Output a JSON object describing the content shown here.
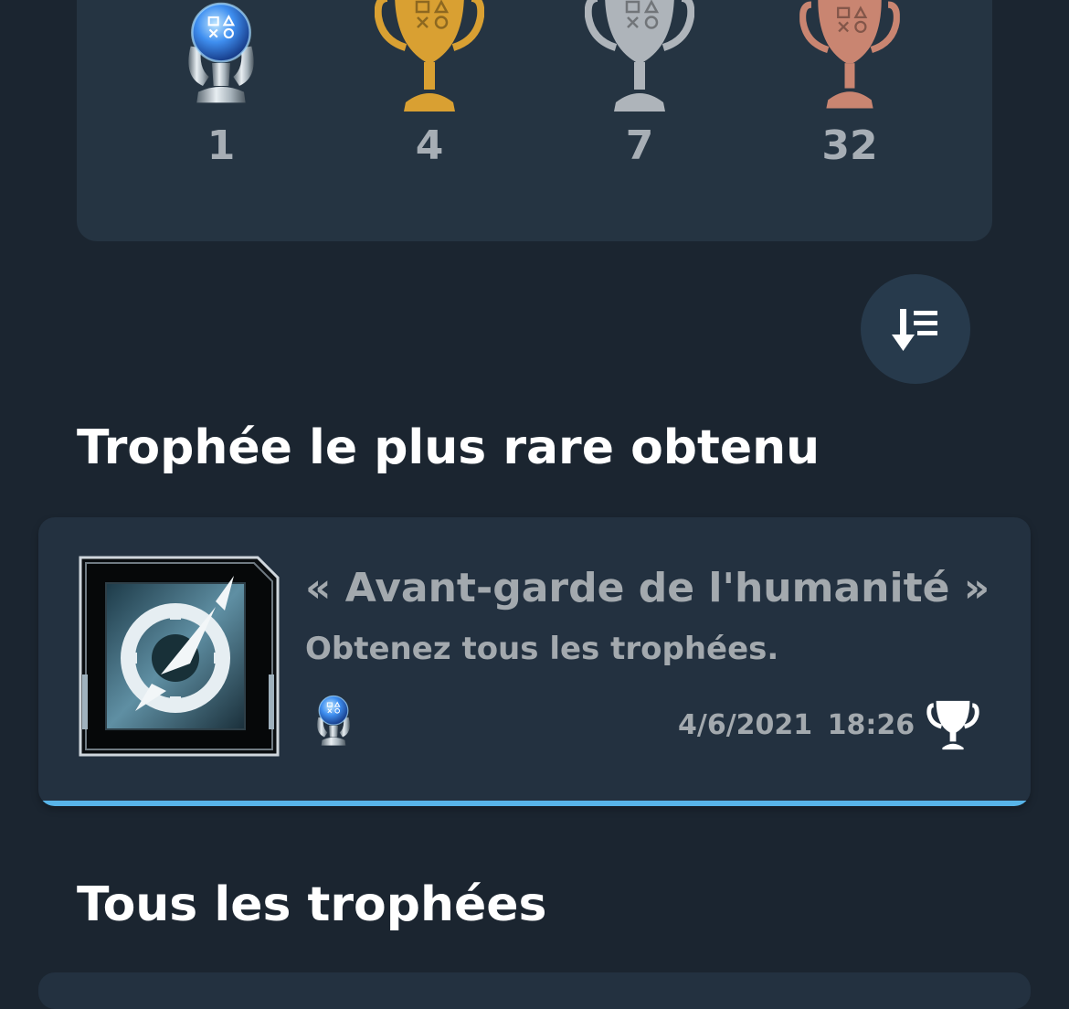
{
  "summary": {
    "trophies": [
      {
        "grade": "platinum",
        "count": "1",
        "icon": "platinum-trophy-icon"
      },
      {
        "grade": "gold",
        "count": "4",
        "icon": "gold-trophy-icon"
      },
      {
        "grade": "silver",
        "count": "7",
        "icon": "silver-trophy-icon"
      },
      {
        "grade": "bronze",
        "count": "32",
        "icon": "bronze-trophy-icon"
      }
    ]
  },
  "sort_button": {
    "icon": "sort-descending-icon"
  },
  "rarest": {
    "heading": "Trophée le plus rare obtenu",
    "title": "« Avant-garde de l'humanité »",
    "description": "Obtenez tous les trophées.",
    "grade": "platinum",
    "date": "4/6/2021",
    "time": "18:26",
    "progress_fraction": 1.0,
    "earned_icon": "trophy-icon"
  },
  "all_trophies": {
    "heading": "Tous les trophées"
  },
  "colors": {
    "background": "#1b2530",
    "card": "#253442",
    "accent": "#58b4e8",
    "muted_text": "#a3a9ae"
  }
}
